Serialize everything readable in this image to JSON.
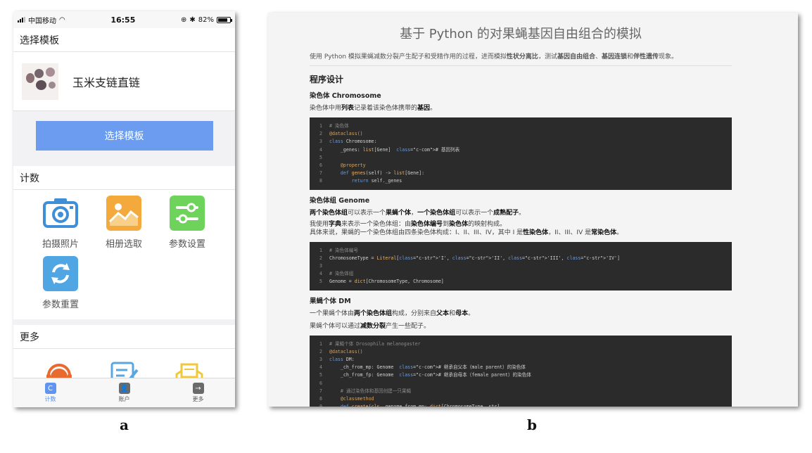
{
  "phone": {
    "status": {
      "carrier": "中国移动",
      "time": "16:55",
      "battery": "82%"
    },
    "template_section": {
      "title": "选择模板",
      "selected_name": "玉米支链直链",
      "button_label": "选择模板"
    },
    "count_section": {
      "title": "计数",
      "tiles": [
        {
          "label": "拍摄照片",
          "icon": "camera-icon",
          "color": "#3f8fd8"
        },
        {
          "label": "相册选取",
          "icon": "photo-album-icon",
          "color": "#f3a93b"
        },
        {
          "label": "参数设置",
          "icon": "settings-sliders-icon",
          "color": "#6ed35a"
        },
        {
          "label": "参数重置",
          "icon": "reset-arrows-icon",
          "color": "#4fa6e3"
        }
      ]
    },
    "more_section": {
      "title": "更多",
      "icons": [
        "customer-service-icon",
        "edit-note-icon",
        "mail-icon"
      ]
    },
    "tabbar": [
      {
        "label": "计数",
        "glyph": "C",
        "active": true
      },
      {
        "label": "账户",
        "glyph": "👤",
        "active": false
      },
      {
        "label": "更多",
        "glyph": "→",
        "active": false
      }
    ]
  },
  "doc": {
    "title": "基于 Python 的对果蝇基因自由组合的模拟",
    "intro_a": "使用 Python 模拟果蝇减数分裂产生配子和受精作用的过程，进而模拟",
    "intro_b": "性状分离比",
    "intro_c": "，测试",
    "intro_d": "基因自由组合",
    "intro_e": "、",
    "intro_f": "基因连锁",
    "intro_g": "和",
    "intro_h": "伴性遗传",
    "intro_i": "现象。",
    "section_title": "程序设计",
    "chromosome": {
      "heading": "染色体 Chromosome",
      "p1_a": "染色体中用",
      "p1_b": "列表",
      "p1_c": "记录着该染色体携带的",
      "p1_d": "基因",
      "p1_e": "。",
      "code": [
        "# 染色体",
        "@dataclass()",
        "class Chromosome:",
        "    _genes: list[Gene]  # 基因列表",
        "",
        "    @property",
        "    def genes(self) -> list[Gene]:",
        "        return self._genes"
      ]
    },
    "genome": {
      "heading": "染色体组 Genome",
      "p1_a": "两个染色体组",
      "p1_b": "可以表示一个",
      "p1_c": "果蝇个体",
      "p1_d": "，",
      "p1_e": "一个染色体组",
      "p1_f": "可以表示一个",
      "p1_g": "成熟配子",
      "p1_h": "。",
      "p2_a": "我使用",
      "p2_b": "字典",
      "p2_c": "来表示一个染色体组：由",
      "p2_d": "染色体编号",
      "p2_e": "到",
      "p2_f": "染色体",
      "p2_g": "的映射构成。",
      "p3_a": "具体来说，果蝇的一个染色体组由四条染色体构成：I、II、III、IV，其中 I 是",
      "p3_b": "性染色体",
      "p3_c": "，II、III、IV 是",
      "p3_d": "常染色体",
      "p3_e": "。",
      "code": [
        "# 染色体编号",
        "ChromosomeType = Literal['I', 'II', 'III', 'IV']",
        "",
        "# 染色体组",
        "Genome = dict[ChromosomeType, Chromosome]"
      ]
    },
    "dm": {
      "heading": "果蝇个体 DM",
      "p1_a": "一个果蝇个体由",
      "p1_b": "两个染色体组",
      "p1_c": "构成，分别来自",
      "p1_d": "父本",
      "p1_e": "和",
      "p1_f": "母本",
      "p1_g": "。",
      "p2_a": "果蝇个体可以通过",
      "p2_b": "减数分裂",
      "p2_c": "产生一些配子。",
      "code": [
        "# 果蝇个体 Drosophila melanogaster",
        "@dataclass()",
        "class DM:",
        "    _ch_from_mp: Genome  # 继承自父本（male parent）的染色体",
        "    _ch_from_fp: Genome  # 继承自母本（female parent）的染色体",
        "",
        "    # 通过染色体和基因创建一只果蝇",
        "    @classmethod",
        "    def create(cls, genome_from_mp: dict[ChromosomeType, str],"
      ]
    }
  },
  "captions": {
    "a": "a",
    "b": "b"
  }
}
